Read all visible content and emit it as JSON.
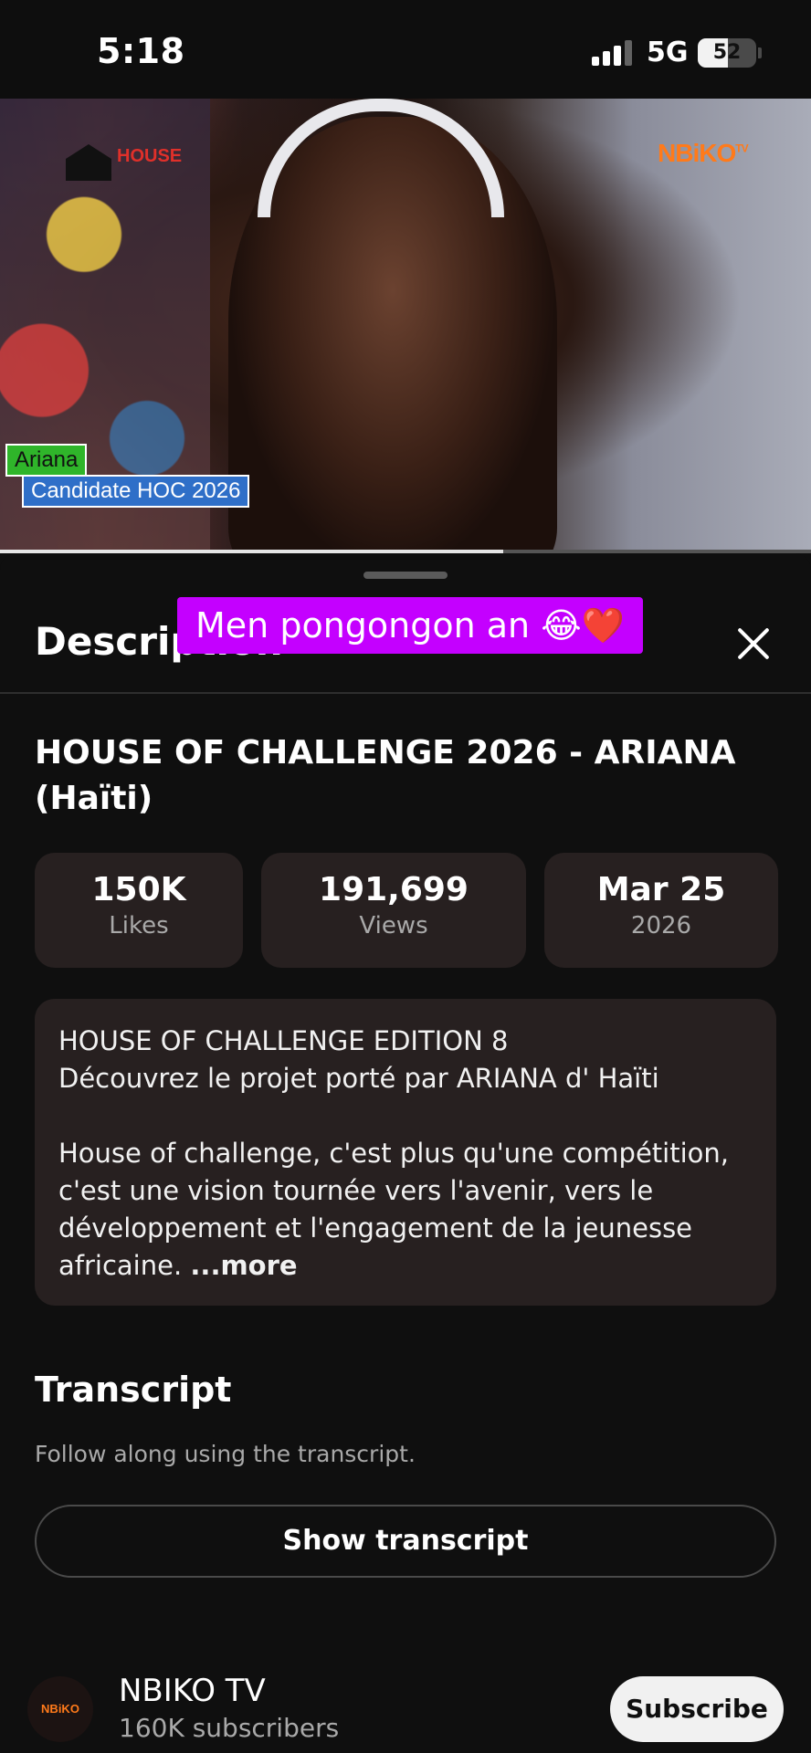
{
  "status_bar": {
    "time": "5:18",
    "network": "5G",
    "battery": "52",
    "battery_level": 0.52
  },
  "video": {
    "logo_left": "HOUSE",
    "logo_right": "NBiKO",
    "logo_right_sup": "TV",
    "name_tag": "Ariana",
    "role_tag": "Candidate HOC 2026",
    "progress": 0.62
  },
  "overlay_caption": "Men pongongon an 😂❤️",
  "sheet": {
    "title": "Description",
    "video_title": "HOUSE OF CHALLENGE 2026 - ARIANA (Haïti)",
    "stats": [
      {
        "value": "150K",
        "label": "Likes"
      },
      {
        "value": "191,699",
        "label": "Views"
      },
      {
        "value": "Mar 25",
        "label": "2026"
      }
    ],
    "description_text": "HOUSE OF CHALLENGE EDITION 8\nDécouvrez le projet porté par ARIANA d' Haïti\n\nHouse of challenge, c'est plus qu'une compétition, c'est une vision tournée vers l'avenir, vers le développement et l'engagement de la jeunesse africaine. ",
    "more_label": "...more",
    "transcript": {
      "title": "Transcript",
      "subtitle": "Follow along using the transcript.",
      "button": "Show transcript"
    },
    "channel": {
      "avatar_text": "NBiKO",
      "name": "NBIKO TV",
      "subscribers": "160K subscribers",
      "subscribe_label": "Subscribe"
    }
  },
  "colors": {
    "background": "#0f0f0f",
    "card": "#272020",
    "caption_bg": "#c400ff",
    "name_tag_bg": "#2fb52a",
    "role_tag_bg": "#2f6fc8",
    "brand_orange": "#ff7a1a"
  }
}
